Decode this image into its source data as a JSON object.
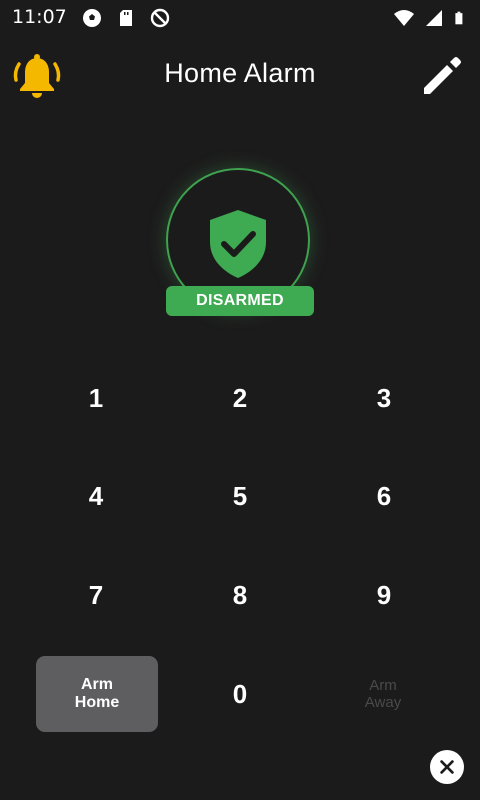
{
  "status_bar": {
    "time": "11:07",
    "left_icons": [
      "soccer-ball-icon",
      "sd-card-icon",
      "do-not-disturb-icon"
    ],
    "right_icons": [
      "wifi-icon",
      "signal-icon",
      "battery-icon"
    ]
  },
  "app_bar": {
    "title": "Home Alarm",
    "bell_icon": "bell-icon",
    "edit_icon": "pencil-icon"
  },
  "alarm": {
    "state": "DISARMED",
    "state_color": "#3eaa51",
    "shield_color": "#3eaa51"
  },
  "keypad": {
    "keys": [
      "1",
      "2",
      "3",
      "4",
      "5",
      "6",
      "7",
      "8",
      "9"
    ],
    "zero": "0",
    "arm_home_line1": "Arm",
    "arm_home_line2": "Home",
    "arm_away_line1": "Arm",
    "arm_away_line2": "Away"
  },
  "close_icon": "close-icon",
  "colors": {
    "background": "#1c1b1c",
    "accent_green": "#3eaa51",
    "bell_yellow": "#f5b800",
    "button_gray": "#5e5d5f"
  }
}
